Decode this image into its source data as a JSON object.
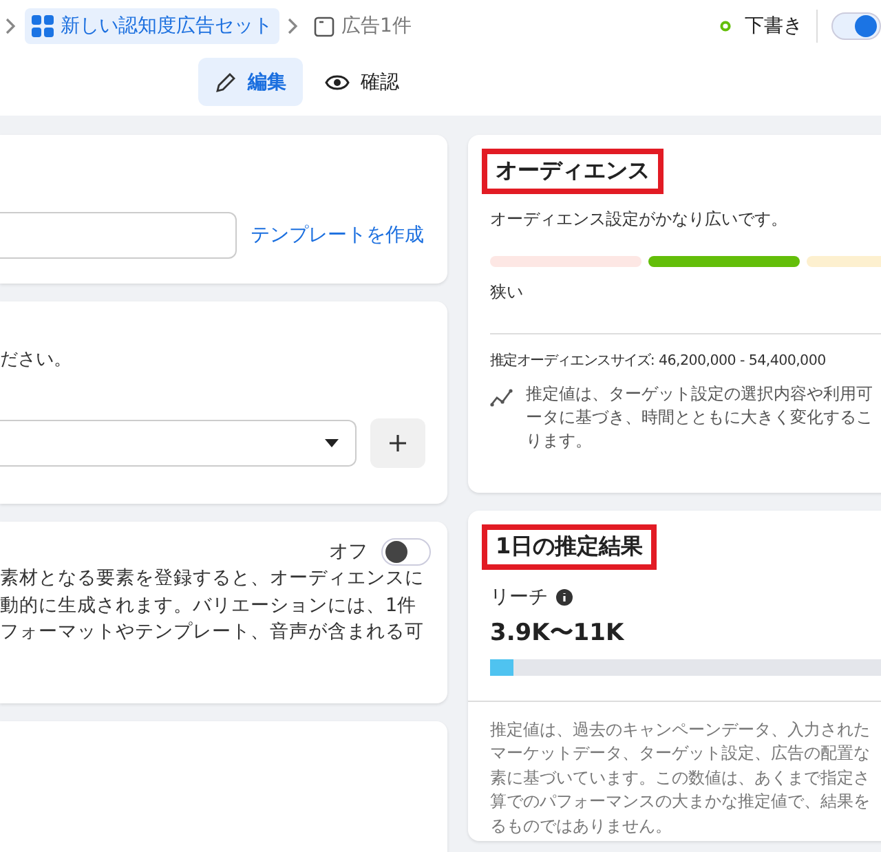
{
  "breadcrumb": [
    {
      "label": "新しい認知度広告セット",
      "kind": "adset",
      "selected": true
    },
    {
      "label": "広告1件",
      "kind": "ad",
      "selected": false
    }
  ],
  "status": {
    "label": "下書き",
    "color": "#63be09"
  },
  "publish_toggle": {
    "on": true
  },
  "modes": [
    {
      "label": "編集",
      "kind": "edit",
      "selected": true
    },
    {
      "label": "確認",
      "kind": "preview",
      "selected": false
    }
  ],
  "name_card": {
    "link": "テンプレートを作成"
  },
  "identity_card": {
    "text": "ださい。"
  },
  "variations_card": {
    "toggle_label": "オフ",
    "on": false,
    "lines": [
      "素材となる要素を登録すると、オーディエンスに",
      "動的に生成されます。バリエーションには、1件",
      "フォーマットやテンプレート、音声が含まれる可"
    ]
  },
  "audience": {
    "title": "オーディエンス",
    "summary": "オーディエンス設定がかなり広いです。",
    "segments": [
      {
        "color": "#fde7e4"
      },
      {
        "color": "#63be09"
      },
      {
        "color": "#fdf0cf"
      }
    ],
    "scale_low": "狭い",
    "size": "推定オーディエンスサイズ: 46,200,000 - 54,400,000",
    "note_lines": [
      "推定値は、ターゲット設定の選択内容や利用可",
      "ータに基づき、時間とともに大きく変化するこ",
      "ります。"
    ]
  },
  "daily": {
    "title": "1日の推定結果",
    "metric": "リーチ",
    "value": "3.9K〜11K",
    "level": 0.055,
    "note_lines": [
      "推定値は、過去のキャンペーンデータ、入力された",
      "マーケットデータ、ターゲット設定、広告の配置な",
      "素に基づいています。この数値は、あくまで指定さ",
      "算でのパフォーマンスの大まかな推定値で、結果を",
      "るものではありません。"
    ]
  }
}
